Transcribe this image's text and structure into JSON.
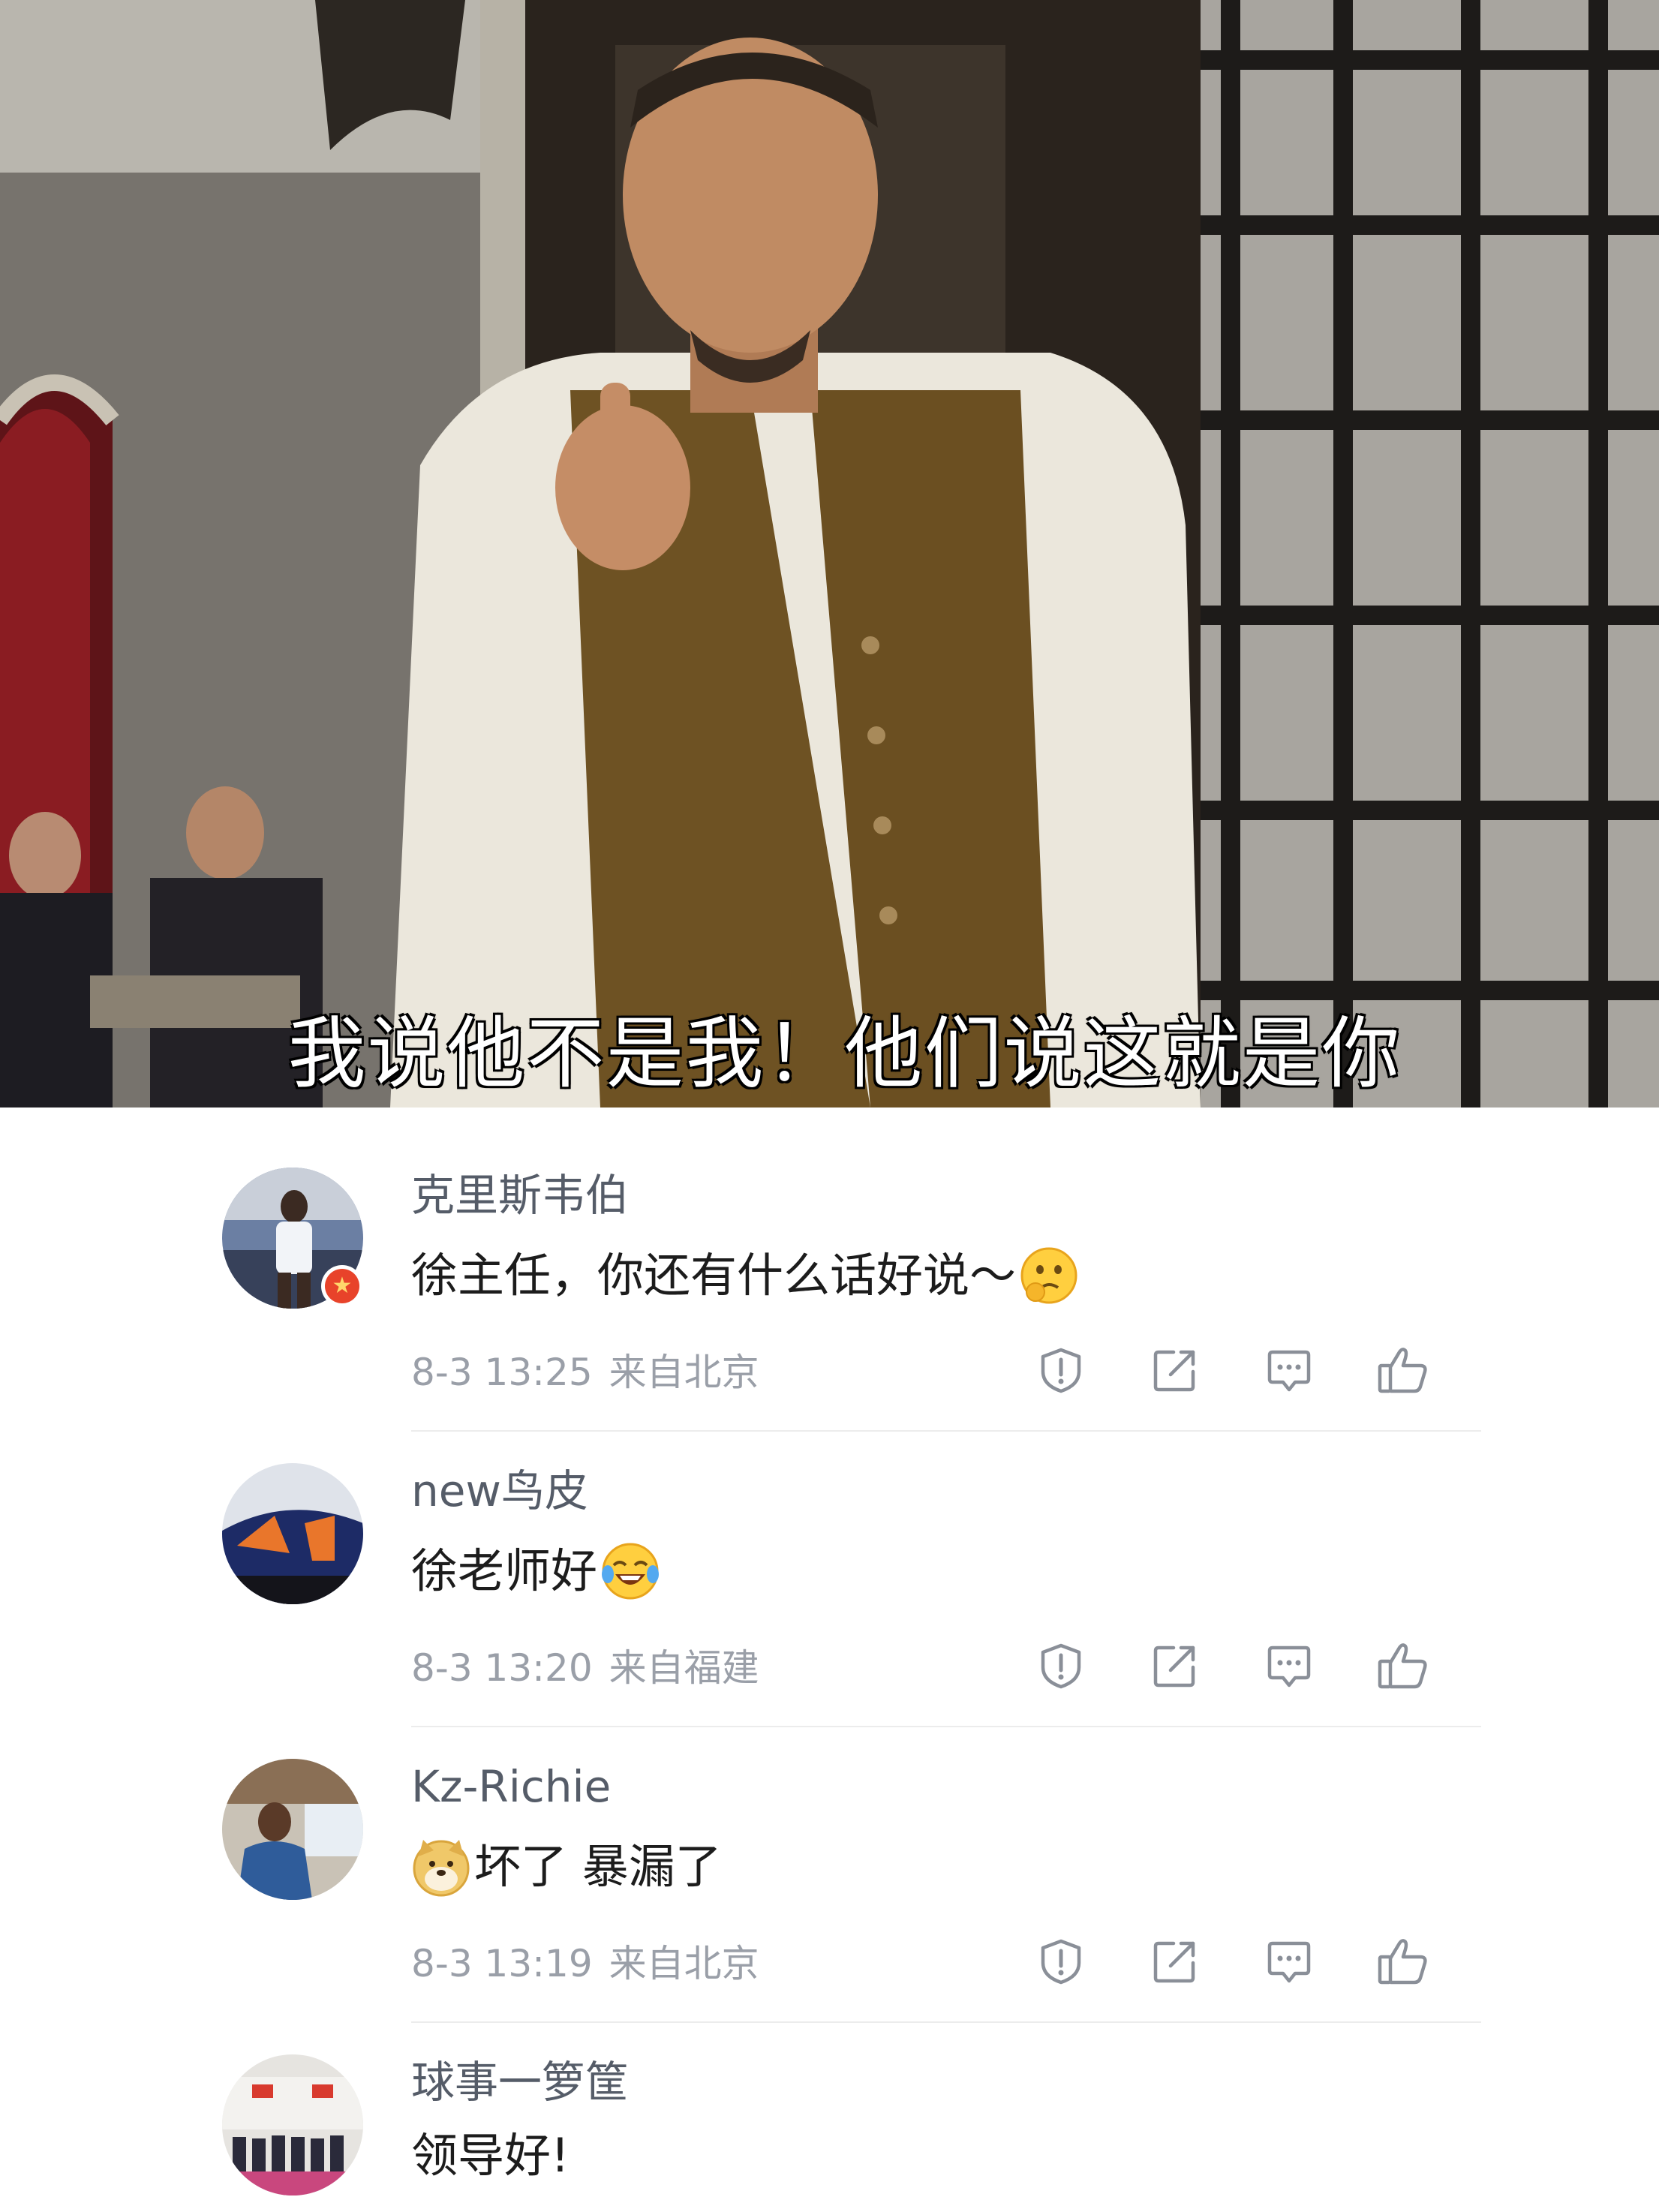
{
  "video": {
    "subtitle": "我说他不是我！他们说这就是你"
  },
  "comments": [
    {
      "username": "克里斯韦伯",
      "text": "徐主任，你还有什么话好说～",
      "emoji": "thinking-emoji",
      "time": "8-3 13:25",
      "location": "来自北京",
      "verified": true
    },
    {
      "username": "new鸟皮",
      "text": "徐老师好",
      "emoji": "tears-of-joy-emoji",
      "time": "8-3 13:20",
      "location": "来自福建",
      "verified": false
    },
    {
      "username": "Kz-Richie",
      "text": "坏了 暴漏了",
      "emoji": "doge-emoji",
      "time": "8-3 13:19",
      "location": "来自北京",
      "verified": false
    },
    {
      "username": "球事一箩筐",
      "text": "领导好!",
      "emoji": "",
      "time": "",
      "location": "",
      "verified": false
    }
  ],
  "colors": {
    "username": "#555c68",
    "meta": "#9a9fa8",
    "text": "#1c1c1c",
    "icon": "#8a8f98",
    "divider": "#ececec",
    "verified_badge": "#e8432a"
  },
  "icons": [
    "report-icon",
    "repost-icon",
    "reply-icon",
    "like-icon"
  ]
}
